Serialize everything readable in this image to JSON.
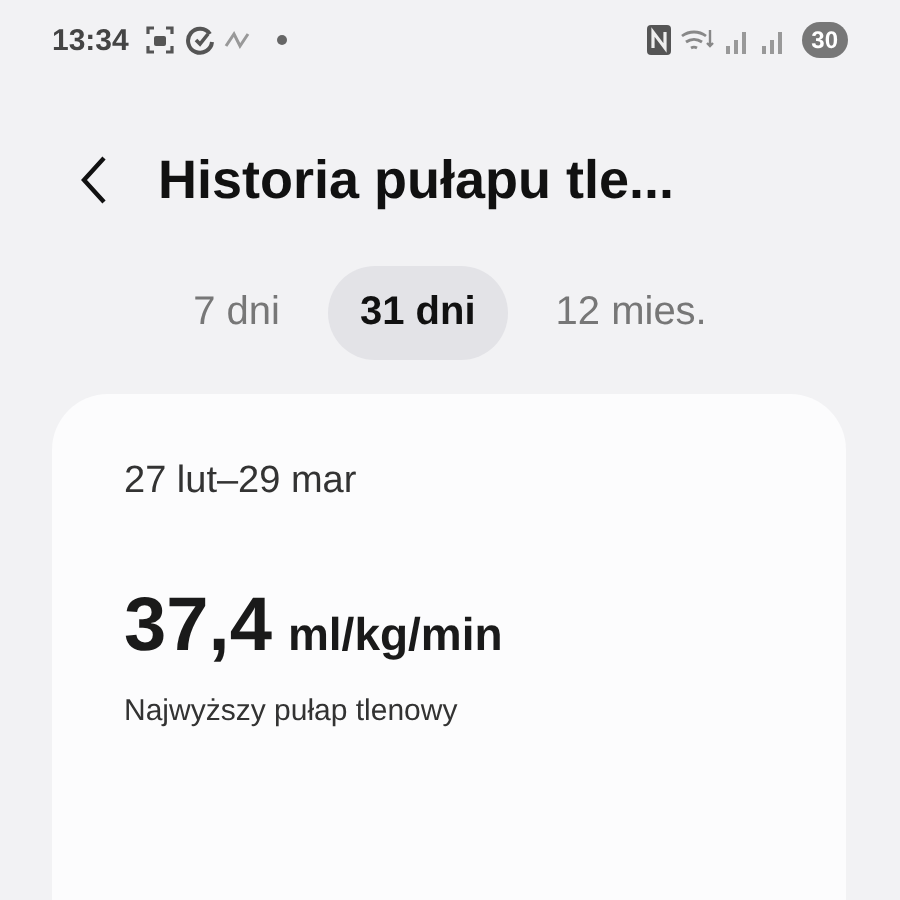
{
  "status_bar": {
    "time": "13:34",
    "battery": "30"
  },
  "header": {
    "title": "Historia pułapu tle..."
  },
  "tabs": [
    {
      "label": "7 dni",
      "selected": false
    },
    {
      "label": "31 dni",
      "selected": true
    },
    {
      "label": "12 mies.",
      "selected": false
    }
  ],
  "card": {
    "date_range": "27 lut–29 mar",
    "value": "37,4",
    "unit": "ml/kg/min",
    "caption": "Najwyższy pułap tlenowy"
  }
}
